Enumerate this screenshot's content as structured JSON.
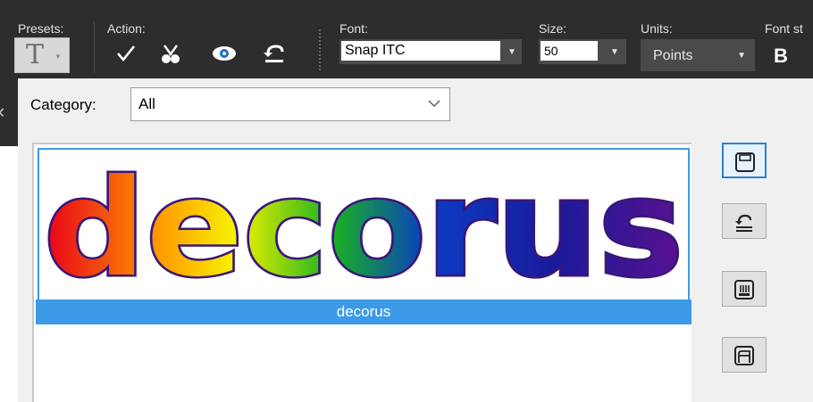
{
  "toolbar": {
    "presets_label": "Presets:",
    "action_label": "Action:",
    "font_label": "Font:",
    "font_value": "Snap ITC",
    "size_label": "Size:",
    "size_value": "50",
    "units_label": "Units:",
    "units_value": "Points",
    "font_style_label": "Font st",
    "bold_label": "B",
    "icons": [
      "apply-check-icon",
      "cancel-icon",
      "preview-eye-icon",
      "undo-icon"
    ]
  },
  "panel": {
    "category_label": "Category:",
    "category_value": "All",
    "preset_name": "decorus",
    "preset_caption": "decorus",
    "side_buttons": [
      "save-preset-icon",
      "restore-preset-icon",
      "rename-preset-icon",
      "delete-preset-icon"
    ]
  },
  "colors": {
    "toolbar_bg": "#2d2d2d",
    "panel_bg": "#f0f0f0",
    "selection": "#3d9ae8"
  }
}
